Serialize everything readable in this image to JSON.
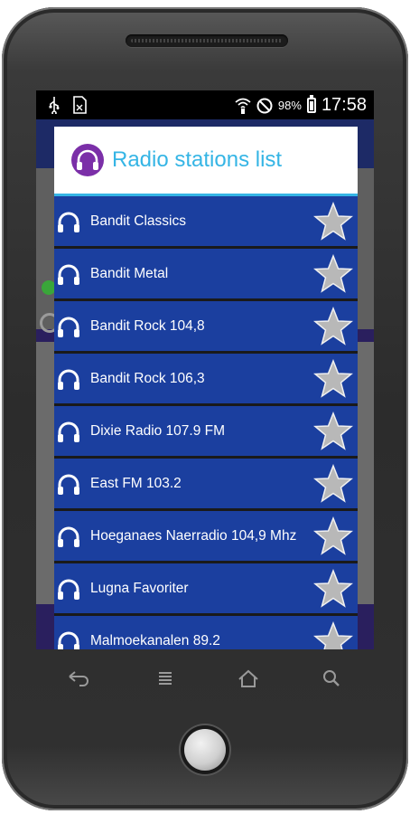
{
  "status_bar": {
    "battery_percent": "98%",
    "time": "17:58",
    "left_icons": [
      "usb-icon",
      "sd-card-icon"
    ],
    "right_icons": [
      "wifi-icon",
      "dnd-icon",
      "battery-icon"
    ]
  },
  "dialog": {
    "title": "Radio stations list",
    "icon": "headphones-icon",
    "accent_color": "#35b5e5",
    "row_color": "#1b3f9f"
  },
  "stations": [
    {
      "name": "Bandit Classics",
      "favorite_icon": "star-icon"
    },
    {
      "name": "Bandit Metal",
      "favorite_icon": "star-icon"
    },
    {
      "name": "Bandit Rock 104,8",
      "favorite_icon": "star-icon"
    },
    {
      "name": "Bandit Rock 106,3",
      "favorite_icon": "star-icon"
    },
    {
      "name": "Dixie Radio 107.9 FM",
      "favorite_icon": "star-icon"
    },
    {
      "name": "East FM 103.2",
      "favorite_icon": "star-icon"
    },
    {
      "name": "Hoeganaes Naerradio 104,9 Mhz",
      "favorite_icon": "star-icon"
    },
    {
      "name": "Lugna Favoriter",
      "favorite_icon": "star-icon"
    },
    {
      "name": "Malmoekanalen 89.2",
      "favorite_icon": "star-icon"
    }
  ],
  "nav_keys": [
    "back-icon",
    "menu-icon",
    "home-icon",
    "search-icon"
  ]
}
